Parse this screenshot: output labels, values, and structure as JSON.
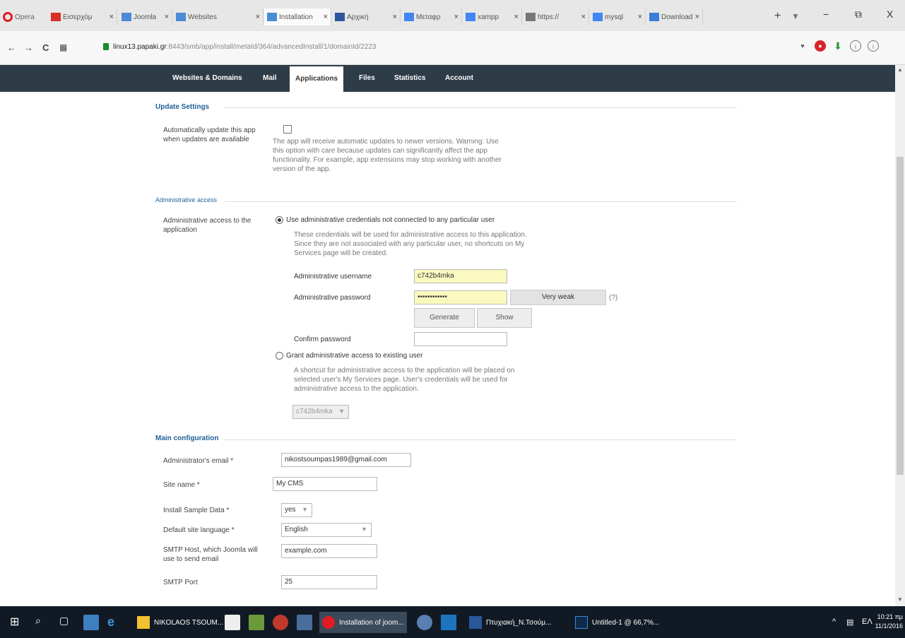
{
  "browser": {
    "menu_label": "Opera",
    "tabs": [
      {
        "label": "Εισερχόμ",
        "color": "#d93025",
        "active": false
      },
      {
        "label": "Joomla",
        "color": "#4a8bd6",
        "active": false
      },
      {
        "label": "Websites",
        "color": "#4a8bd6",
        "active": false
      },
      {
        "label": "Installation",
        "color": "#4a8bd6",
        "active": true
      },
      {
        "label": "Αρχική",
        "color": "#2b579a",
        "active": false
      },
      {
        "label": "Μεταφρ",
        "color": "#4285f4",
        "active": false
      },
      {
        "label": "xampp",
        "color": "#4285f4",
        "active": false
      },
      {
        "label": "https://",
        "color": "#777777",
        "active": false
      },
      {
        "label": "mysql",
        "color": "#4285f4",
        "active": false
      },
      {
        "label": "Download",
        "color": "#3b7dd8",
        "active": false
      }
    ],
    "new_tab": "+",
    "url_host": "linux13.papaki.gr",
    "url_rest": ":8443/smb/app/install/metaId/364/advancedInstall/1/domainId/2223",
    "window_controls": {
      "minimize": "−",
      "restore": "⧉",
      "close": "X"
    }
  },
  "plesk_nav": {
    "items": [
      {
        "label": "Websites & Domains",
        "active": false
      },
      {
        "label": "Mail",
        "active": false
      },
      {
        "label": "Applications",
        "active": true
      },
      {
        "label": "Files",
        "active": false
      },
      {
        "label": "Statistics",
        "active": false
      },
      {
        "label": "Account",
        "active": false
      }
    ]
  },
  "update_settings": {
    "title": "Update Settings",
    "label": "Automatically update this app when updates are available",
    "checked": false,
    "hint": "The app will receive automatic updates to newer versions. Warning: Use this option with care because updates can significantly affect the app functionality. For example, app extensions may stop working with another version of the app."
  },
  "admin_access": {
    "title": "Administrative access",
    "label": "Administrative access to the application",
    "option1": "Use administrative credentials not connected to any particular user",
    "option1_hint": "These credentials will be used for administrative access to this application. Since they are not associated with any particular user, no shortcuts on My Services page will be created.",
    "username_label": "Administrative username",
    "username_value": "c742b4mka",
    "password_label": "Administrative password",
    "password_value": "••••••••••••",
    "strength": "Very weak",
    "help": "(?)",
    "generate": "Generate",
    "show": "Show",
    "confirm_label": "Confirm password",
    "confirm_value": "",
    "option2": "Grant administrative access to existing user",
    "option2_hint": "A shortcut for administrative access to the application will be placed on selected user's My Services page. User's credentials will be used for administrative access to the application.",
    "user_select": "c742b4mka"
  },
  "main_config": {
    "title": "Main configuration",
    "email_label": "Administrator's email *",
    "email_value": "nikostsoumpas1989@gmail.com",
    "site_label": "Site name *",
    "site_value": "My CMS",
    "sample_label": "Install Sample Data *",
    "sample_value": "yes",
    "lang_label": "Default site language *",
    "lang_value": "English",
    "smtp_host_label": "SMTP Host, which Joomla will use to send email",
    "smtp_host_value": "example.com",
    "smtp_port_label": "SMTP Port",
    "smtp_port_value": "25"
  },
  "taskbar": {
    "items": [
      {
        "label": "NIKOLAOS TSOUM...",
        "color": "#f2c230",
        "active": false
      },
      {
        "label": "Installation of joom...",
        "color": "#e01b22",
        "active": true
      },
      {
        "label": "Πτυχιακή_Ν.Τσούμ...",
        "color": "#2b579a",
        "active": false
      },
      {
        "label": "Untitled-1 @ 66,7%...",
        "color": "#2a6fb5",
        "active": false
      }
    ],
    "lang": "ΕΛ",
    "time": "10:21 πμ",
    "date": "11/1/2016"
  }
}
